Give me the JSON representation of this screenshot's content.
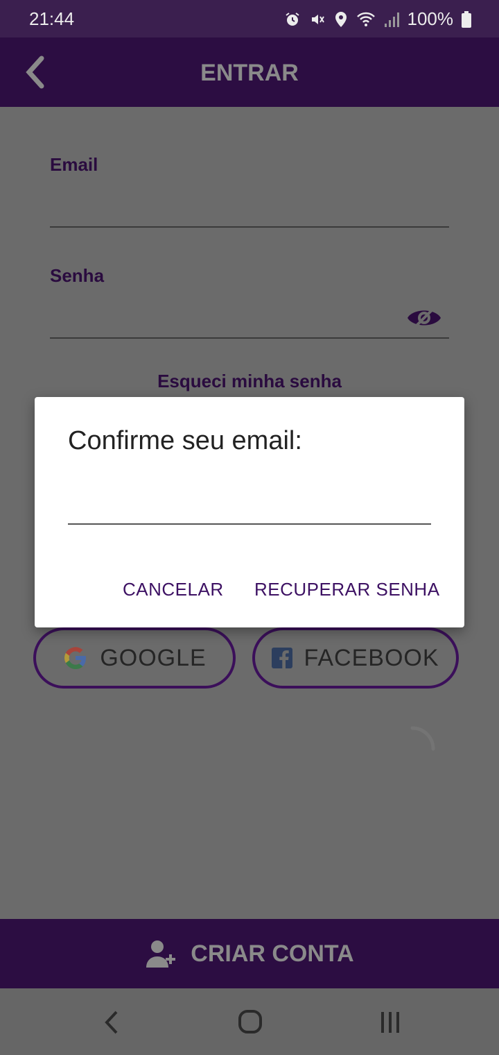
{
  "status_bar": {
    "time": "21:44",
    "battery": "100%"
  },
  "app_bar": {
    "title": "ENTRAR"
  },
  "form": {
    "email_label": "Email",
    "password_label": "Senha",
    "forgot_password": "Esqueci minha senha"
  },
  "social": {
    "google_label": "GOOGLE",
    "facebook_label": "FACEBOOK"
  },
  "bottom_bar": {
    "create_account_label": "CRIAR CONTA"
  },
  "dialog": {
    "title": "Confirme seu email:",
    "input_value": "",
    "cancel_label": "CANCELAR",
    "recover_label": "RECUPERAR SENHA"
  },
  "colors": {
    "brand_purple": "#2c0d42",
    "accent_text": "#3d1163",
    "overlay": "#6b6b6b"
  },
  "icons": [
    "alarm-icon",
    "mute-icon",
    "location-icon",
    "wifi-icon",
    "signal-icon",
    "battery-icon",
    "back-arrow-icon",
    "eye-off-icon",
    "google-icon",
    "facebook-icon",
    "add-user-icon",
    "nav-back-icon",
    "nav-home-icon",
    "nav-recents-icon"
  ]
}
